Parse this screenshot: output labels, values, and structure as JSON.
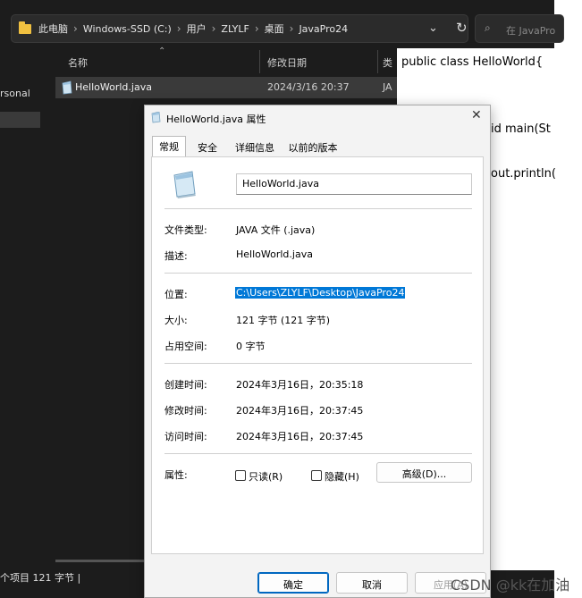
{
  "explorer": {
    "breadcrumbs": [
      "此电脑",
      "Windows-SSD (C:)",
      "用户",
      "ZLYLF",
      "桌面",
      "JavaPro24"
    ],
    "search_placeholder": "在 JavaPro",
    "sidebar_label": "rsonal",
    "columns": {
      "name": "名称",
      "modified": "修改日期",
      "type": "类"
    },
    "file": {
      "name": "HelloWorld.java",
      "modified": "2024/3/16 20:37",
      "type": "JA"
    },
    "status": "个项目  121 字节  |"
  },
  "editor": {
    "lines": [
      "public class HelloWorld{",
      "id main(St",
      "out.println("
    ]
  },
  "dialog": {
    "title": "HelloWorld.java 属性",
    "tabs": [
      "常规",
      "安全",
      "详细信息",
      "以前的版本"
    ],
    "filename": "HelloWorld.java",
    "file_type_label": "文件类型:",
    "file_type": "JAVA 文件 (.java)",
    "description_label": "描述:",
    "description": "HelloWorld.java",
    "location_label": "位置:",
    "location": "C:\\Users\\ZLYLF\\Desktop\\JavaPro24",
    "size_label": "大小:",
    "size": "121 字节 (121 字节)",
    "disk_size_label": "占用空间:",
    "disk_size": "0 字节",
    "created_label": "创建时间:",
    "created": "2024年3月16日，20:35:18",
    "modified_label": "修改时间:",
    "modified": "2024年3月16日，20:37:45",
    "accessed_label": "访问时间:",
    "accessed": "2024年3月16日，20:37:45",
    "attributes_label": "属性:",
    "readonly": "只读(R)",
    "hidden": "隐藏(H)",
    "advanced": "高级(D)...",
    "ok": "确定",
    "cancel": "取消",
    "apply": "应用(A)"
  },
  "watermark": "CSDN @kk在加油",
  "colors": {
    "selection": "#0078d7",
    "explorer_bg": "#1c1c1c",
    "dialog_bg": "#f3f3f3"
  }
}
